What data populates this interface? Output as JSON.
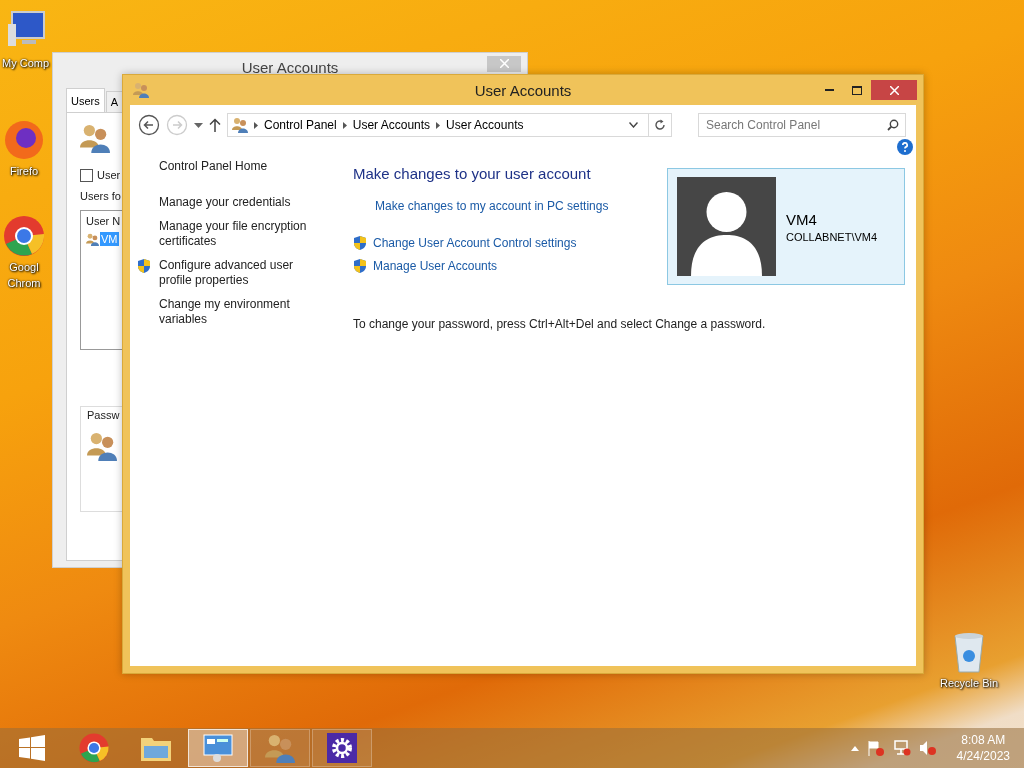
{
  "desktop_icons": [
    {
      "kind": "computer",
      "lines": [
        "My Comp"
      ]
    },
    {
      "kind": "firefox",
      "lines": [
        "Firefo"
      ]
    },
    {
      "kind": "chrome",
      "lines": [
        "Googl",
        "Chrom"
      ]
    },
    {
      "kind": "recycle",
      "lines": [
        "Recycle Bin"
      ]
    }
  ],
  "back_window": {
    "title": "User Accounts",
    "tabs": [
      {
        "label": "Users",
        "selected": true
      },
      {
        "label": "A",
        "selected": false
      }
    ],
    "checkbox": {
      "label": "User",
      "checked": false
    },
    "list_label": "Users fo",
    "list_header": "User N",
    "list_items": [
      {
        "label": "VM",
        "selected": true
      }
    ],
    "group_label": "Passw"
  },
  "window": {
    "title": "User Accounts",
    "breadcrumb": [
      "Control Panel",
      "User Accounts",
      "User Accounts"
    ],
    "search": {
      "placeholder": "Search Control Panel"
    },
    "sidebar": [
      {
        "label": "Control Panel Home",
        "kind": "home"
      },
      {
        "label": "Manage your credentials",
        "kind": "link"
      },
      {
        "label": "Manage your file encryption certificates",
        "kind": "link"
      },
      {
        "label": "Configure advanced user profile properties",
        "kind": "shield"
      },
      {
        "label": "Change my environment variables",
        "kind": "link"
      }
    ],
    "heading": "Make changes to your user account",
    "links": [
      {
        "label": "Make changes to my account in PC settings",
        "kind": "link"
      },
      {
        "label": "Change User Account Control settings",
        "kind": "shield"
      },
      {
        "label": "Manage User Accounts",
        "kind": "shield"
      }
    ],
    "user": {
      "name": "VM4",
      "domain": "COLLABNET\\VM4"
    },
    "note": "To change your password, press Ctrl+Alt+Del and select Change a password."
  },
  "taskbar": {
    "items": [
      {
        "kind": "start",
        "selected": false
      },
      {
        "kind": "chrome",
        "selected": false
      },
      {
        "kind": "explorer",
        "selected": false
      },
      {
        "kind": "control-panel",
        "selected": true
      },
      {
        "kind": "users",
        "selected": false
      },
      {
        "kind": "settings",
        "selected": false
      }
    ],
    "time": "8:08 AM",
    "date": "4/24/2023"
  }
}
